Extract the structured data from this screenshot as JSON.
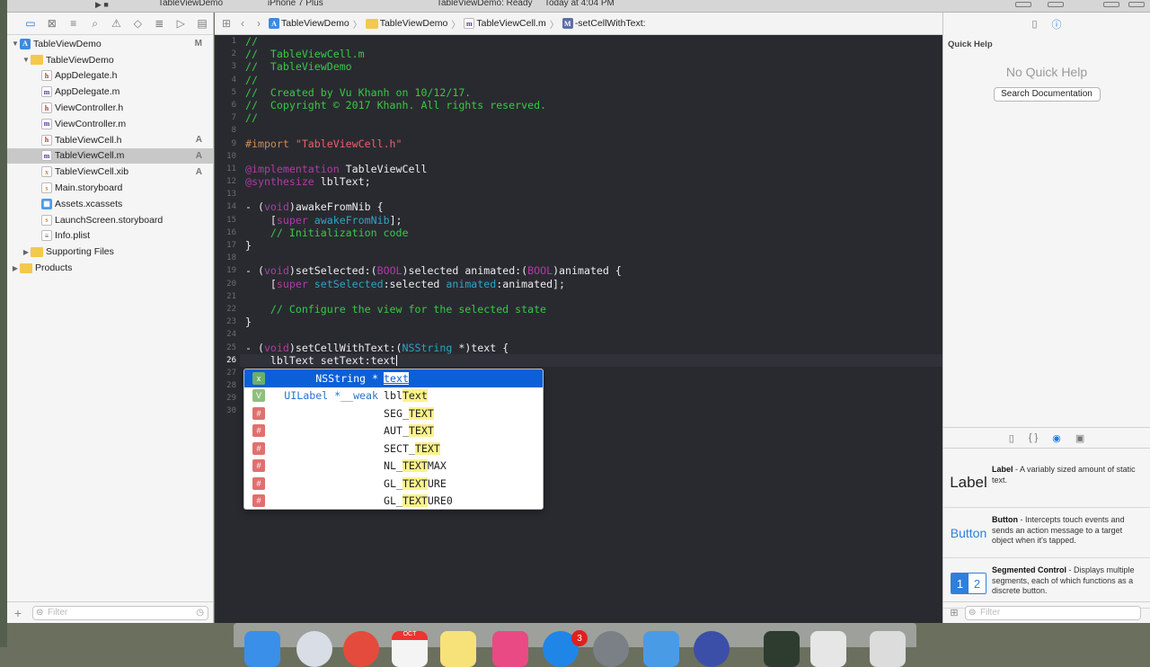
{
  "topbar": {
    "scheme": "TableViewDemo",
    "device": "iPhone 7 Plus",
    "status": "TableViewDemo: Ready",
    "time": "Today at 4:04 PM"
  },
  "navigator": {
    "items": [
      {
        "label": "TableViewDemo",
        "icon": "project-icon",
        "status": "M",
        "indent": 0,
        "disc": "▼"
      },
      {
        "label": "TableViewDemo",
        "icon": "folder-icon",
        "status": "",
        "indent": 1,
        "disc": "▼"
      },
      {
        "label": "AppDelegate.h",
        "icon": "header-file-icon",
        "status": "",
        "indent": 2,
        "disc": ""
      },
      {
        "label": "AppDelegate.m",
        "icon": "impl-file-icon",
        "status": "",
        "indent": 2,
        "disc": ""
      },
      {
        "label": "ViewController.h",
        "icon": "header-file-icon",
        "status": "",
        "indent": 2,
        "disc": ""
      },
      {
        "label": "ViewController.m",
        "icon": "impl-file-icon",
        "status": "",
        "indent": 2,
        "disc": ""
      },
      {
        "label": "TableViewCell.h",
        "icon": "header-file-icon",
        "status": "A",
        "indent": 2,
        "disc": ""
      },
      {
        "label": "TableViewCell.m",
        "icon": "impl-file-icon",
        "status": "A",
        "indent": 2,
        "disc": "",
        "selected": true
      },
      {
        "label": "TableViewCell.xib",
        "icon": "xib-file-icon",
        "status": "A",
        "indent": 2,
        "disc": ""
      },
      {
        "label": "Main.storyboard",
        "icon": "storyboard-file-icon",
        "status": "",
        "indent": 2,
        "disc": ""
      },
      {
        "label": "Assets.xcassets",
        "icon": "assets-icon",
        "status": "",
        "indent": 2,
        "disc": ""
      },
      {
        "label": "LaunchScreen.storyboard",
        "icon": "storyboard-file-icon",
        "status": "",
        "indent": 2,
        "disc": ""
      },
      {
        "label": "Info.plist",
        "icon": "plist-file-icon",
        "status": "",
        "indent": 2,
        "disc": ""
      },
      {
        "label": "Supporting Files",
        "icon": "folder-icon",
        "status": "",
        "indent": 1,
        "disc": "▶"
      },
      {
        "label": "Products",
        "icon": "folder-icon",
        "status": "",
        "indent": 0,
        "disc": "▶"
      }
    ],
    "filter_placeholder": "Filter"
  },
  "jumpbar": {
    "crumbs": [
      "TableViewDemo",
      "TableViewDemo",
      "TableViewCell.m",
      "-setCellWithText:"
    ]
  },
  "editor": {
    "line_numbers": [
      "1",
      "2",
      "3",
      "4",
      "5",
      "6",
      "7",
      "8",
      "9",
      "10",
      "11",
      "12",
      "13",
      "14",
      "15",
      "16",
      "17",
      "18",
      "19",
      "20",
      "21",
      "22",
      "23",
      "24",
      "25",
      "26",
      "27",
      "28",
      "29",
      "30"
    ],
    "current_line": "26",
    "lines": [
      [
        {
          "t": "//",
          "k": "c"
        }
      ],
      [
        {
          "t": "//  TableViewCell.m",
          "k": "c"
        }
      ],
      [
        {
          "t": "//  TableViewDemo",
          "k": "c"
        }
      ],
      [
        {
          "t": "//",
          "k": "c"
        }
      ],
      [
        {
          "t": "//  Created by Vu Khanh on 10/12/17.",
          "k": "c"
        }
      ],
      [
        {
          "t": "//  Copyright © 2017 Khanh. All rights reserved.",
          "k": "c"
        }
      ],
      [
        {
          "t": "//",
          "k": "c"
        }
      ],
      [],
      [
        {
          "t": "#import ",
          "k": "pp"
        },
        {
          "t": "\"TableViewCell.h\"",
          "k": "st2"
        }
      ],
      [],
      [
        {
          "t": "@implementation",
          "k": "kw"
        },
        {
          "t": " TableViewCell",
          "k": ""
        }
      ],
      [
        {
          "t": "@synthesize",
          "k": "kw"
        },
        {
          "t": " lblText;",
          "k": ""
        }
      ],
      [],
      [
        {
          "t": "- (",
          "k": ""
        },
        {
          "t": "void",
          "k": "kw"
        },
        {
          "t": ")awakeFromNib {",
          "k": ""
        }
      ],
      [
        {
          "t": "    [",
          "k": ""
        },
        {
          "t": "super",
          "k": "kw"
        },
        {
          "t": " ",
          "k": ""
        },
        {
          "t": "awakeFromNib",
          "k": "mt"
        },
        {
          "t": "];",
          "k": ""
        }
      ],
      [
        {
          "t": "    // Initialization code",
          "k": "c"
        }
      ],
      [
        {
          "t": "}",
          "k": ""
        }
      ],
      [],
      [
        {
          "t": "- (",
          "k": ""
        },
        {
          "t": "void",
          "k": "kw"
        },
        {
          "t": ")setSelected:(",
          "k": ""
        },
        {
          "t": "BOOL",
          "k": "kw"
        },
        {
          "t": ")selected animated:(",
          "k": ""
        },
        {
          "t": "BOOL",
          "k": "kw"
        },
        {
          "t": ")animated {",
          "k": ""
        }
      ],
      [
        {
          "t": "    [",
          "k": ""
        },
        {
          "t": "super",
          "k": "kw"
        },
        {
          "t": " ",
          "k": ""
        },
        {
          "t": "setSelected",
          "k": "mt"
        },
        {
          "t": ":selected ",
          "k": ""
        },
        {
          "t": "animated",
          "k": "mt"
        },
        {
          "t": ":animated];",
          "k": ""
        }
      ],
      [],
      [
        {
          "t": "    // Configure the view for the selected state",
          "k": "c"
        }
      ],
      [
        {
          "t": "}",
          "k": ""
        }
      ],
      [],
      [
        {
          "t": "- (",
          "k": ""
        },
        {
          "t": "void",
          "k": "kw"
        },
        {
          "t": ")setCellWithText:(",
          "k": ""
        },
        {
          "t": "NSString",
          "k": "ty"
        },
        {
          "t": " *)text {",
          "k": ""
        }
      ],
      [
        {
          "t": "    lblText setText:text",
          "k": ""
        }
      ],
      [],
      [],
      [],
      []
    ]
  },
  "autocomplete": {
    "items": [
      {
        "badge": "x",
        "badge_kind": "x",
        "rtype": "NSString *",
        "pre": "",
        "hl": "text",
        "post": "",
        "selected": true
      },
      {
        "badge": "V",
        "badge_kind": "v",
        "rtype": "UILabel *__weak",
        "pre": "lbl",
        "hl": "Text",
        "post": ""
      },
      {
        "badge": "#",
        "badge_kind": "h",
        "rtype": "",
        "pre": "SEG_",
        "hl": "TEXT",
        "post": ""
      },
      {
        "badge": "#",
        "badge_kind": "h",
        "rtype": "",
        "pre": "AUT_",
        "hl": "TEXT",
        "post": ""
      },
      {
        "badge": "#",
        "badge_kind": "h",
        "rtype": "",
        "pre": "SECT_",
        "hl": "TEXT",
        "post": ""
      },
      {
        "badge": "#",
        "badge_kind": "h",
        "rtype": "",
        "pre": "NL_",
        "hl": "TEXT",
        "post": "MAX"
      },
      {
        "badge": "#",
        "badge_kind": "h",
        "rtype": "",
        "pre": "GL_",
        "hl": "TEXT",
        "post": "URE"
      },
      {
        "badge": "#",
        "badge_kind": "h",
        "rtype": "",
        "pre": "GL_",
        "hl": "TEXT",
        "post": "URE0"
      }
    ]
  },
  "inspector": {
    "title": "Quick Help",
    "empty": "No Quick Help",
    "search_button": "Search Documentation",
    "library": [
      {
        "name": "Label",
        "desc": " - A variably sized amount of static text.",
        "preview": "Label"
      },
      {
        "name": "Button",
        "desc": " - Intercepts touch events and sends an action message to a target object when it's tapped.",
        "preview": "Button"
      },
      {
        "name": "Segmented Control",
        "desc": " - Displays multiple segments, each of which functions as a discrete button.",
        "preview": "segmented"
      }
    ],
    "filter_placeholder": "Filter",
    "segment_labels": [
      "1",
      "2"
    ]
  },
  "dock": {
    "badge_count": "3",
    "calendar_month": "OCT"
  },
  "colors": {
    "editor_bg": "#292a30",
    "comment": "#37c945",
    "keyword": "#b03ba5",
    "string": "#f25e6b",
    "selection": "#0b60d8"
  }
}
